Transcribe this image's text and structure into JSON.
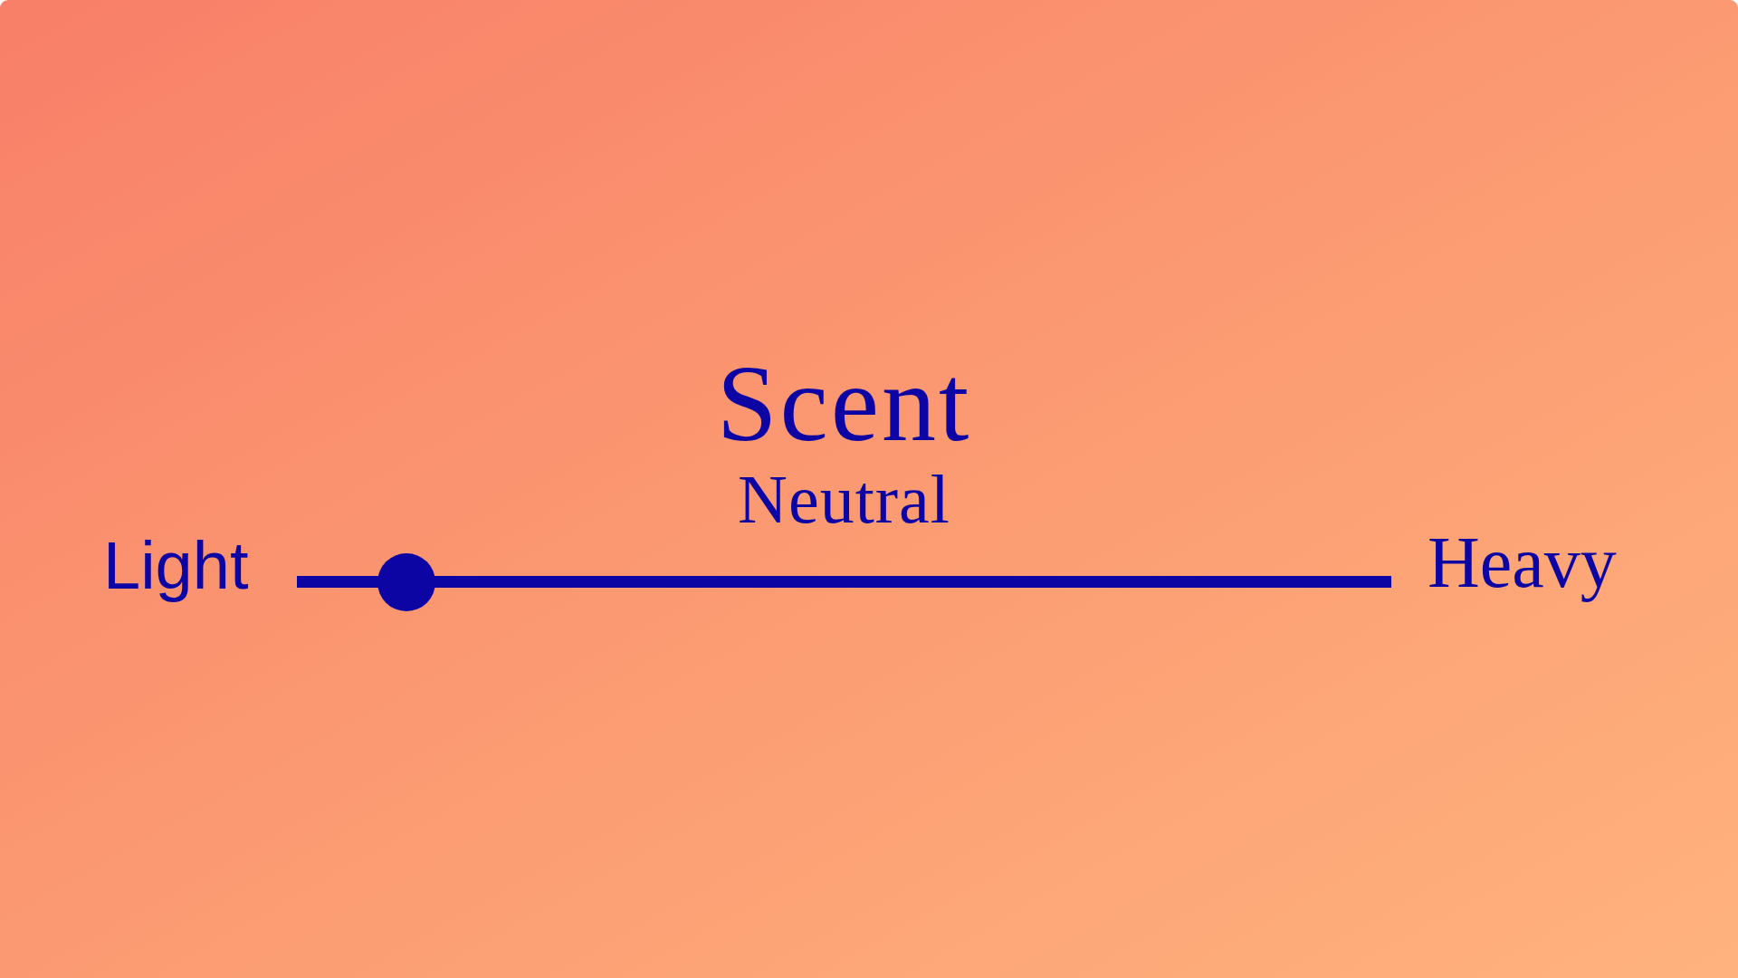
{
  "slider": {
    "title": "Scent",
    "reading": "Neutral",
    "min_label": "Light",
    "max_label": "Heavy",
    "level": 0.1
  }
}
